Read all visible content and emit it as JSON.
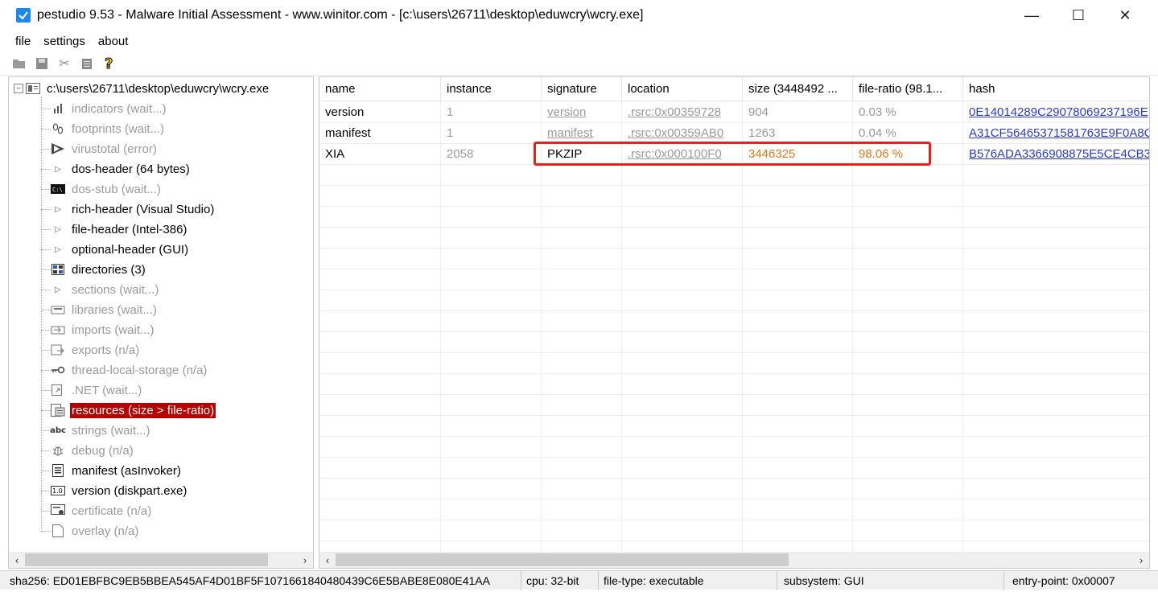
{
  "window": {
    "title": "pestudio 9.53 - Malware Initial Assessment - www.winitor.com - [c:\\users\\26711\\desktop\\eduwcry\\wcry.exe]",
    "minimize": "—",
    "maximize": "☐",
    "close": "✕"
  },
  "menu": [
    "file",
    "settings",
    "about"
  ],
  "toolbar": {
    "icons": [
      "open-icon",
      "save-icon",
      "cut-icon",
      "clipboard-icon",
      "help-icon"
    ]
  },
  "tree": {
    "root": "c:\\users\\26711\\desktop\\eduwcry\\wcry.exe",
    "items": [
      {
        "label": "indicators (wait...)",
        "dim": true,
        "icon": "bar-chart-icon"
      },
      {
        "label": "footprints (wait...)",
        "dim": true,
        "icon": "footprints-icon"
      },
      {
        "label": "virustotal (error)",
        "dim": true,
        "icon": "virustotal-icon"
      },
      {
        "label": "dos-header (64 bytes)",
        "dim": false,
        "icon": "expand-icon"
      },
      {
        "label": "dos-stub (wait...)",
        "dim": true,
        "icon": "console-icon"
      },
      {
        "label": "rich-header (Visual Studio)",
        "dim": false,
        "icon": "expand-icon"
      },
      {
        "label": "file-header (Intel-386)",
        "dim": false,
        "icon": "expand-icon"
      },
      {
        "label": "optional-header (GUI)",
        "dim": false,
        "icon": "expand-icon"
      },
      {
        "label": "directories (3)",
        "dim": false,
        "icon": "directory-icon"
      },
      {
        "label": "sections (wait...)",
        "dim": true,
        "icon": "expand-icon"
      },
      {
        "label": "libraries (wait...)",
        "dim": true,
        "icon": "library-icon"
      },
      {
        "label": "imports (wait...)",
        "dim": true,
        "icon": "import-icon"
      },
      {
        "label": "exports (n/a)",
        "dim": true,
        "icon": "export-icon"
      },
      {
        "label": "thread-local-storage (n/a)",
        "dim": true,
        "icon": "key-icon"
      },
      {
        "label": ".NET (wait...)",
        "dim": true,
        "icon": "dotnet-icon"
      },
      {
        "label": "resources (size > file-ratio)",
        "dim": false,
        "selected": true,
        "icon": "resources-icon"
      },
      {
        "label": "strings (wait...)",
        "dim": true,
        "icon": "abc-icon"
      },
      {
        "label": "debug (n/a)",
        "dim": true,
        "icon": "bug-icon"
      },
      {
        "label": "manifest (asInvoker)",
        "dim": false,
        "icon": "manifest-icon"
      },
      {
        "label": "version (diskpart.exe)",
        "dim": false,
        "icon": "version-icon"
      },
      {
        "label": "certificate (n/a)",
        "dim": true,
        "icon": "certificate-icon"
      },
      {
        "label": "overlay (n/a)",
        "dim": true,
        "icon": "overlay-icon"
      }
    ]
  },
  "table": {
    "columns": [
      "name",
      "instance",
      "signature",
      "location",
      "size (3448492 ...",
      "file-ratio  (98.1...",
      "hash"
    ],
    "rows": [
      {
        "name": "version",
        "instance": "1",
        "signature": "version",
        "location": ".rsrc:0x00359728",
        "size": "904",
        "ratio": "0.03 %",
        "hash": "0E14014289C29078069237196E"
      },
      {
        "name": "manifest",
        "instance": "1",
        "signature": "manifest",
        "location": ".rsrc:0x00359AB0",
        "size": "1263",
        "ratio": "0.04 %",
        "hash": "A31CF56465371581763E9F0A8C"
      },
      {
        "name": "XIA",
        "instance": "2058",
        "signature": "PKZIP",
        "location": ".rsrc:0x000100F0",
        "size": "3446325",
        "ratio": "98.06 %",
        "hash": "B576ADA3366908875E5CE4CB3"
      }
    ]
  },
  "status": {
    "sha256": "sha256: ED01EBFBC9EB5BBEA545AF4D01BF5F1071661840480439C6E5BABE8E080E41AA",
    "cpu": "cpu: 32-bit",
    "filetype": "file-type: executable",
    "subsystem": "subsystem: GUI",
    "entrypoint": "entry-point: 0x00007"
  },
  "colors": {
    "selected": "#b50000",
    "highlight": "#e2231a",
    "orange": "#d87a1e",
    "hash": "#2e3bbf"
  }
}
